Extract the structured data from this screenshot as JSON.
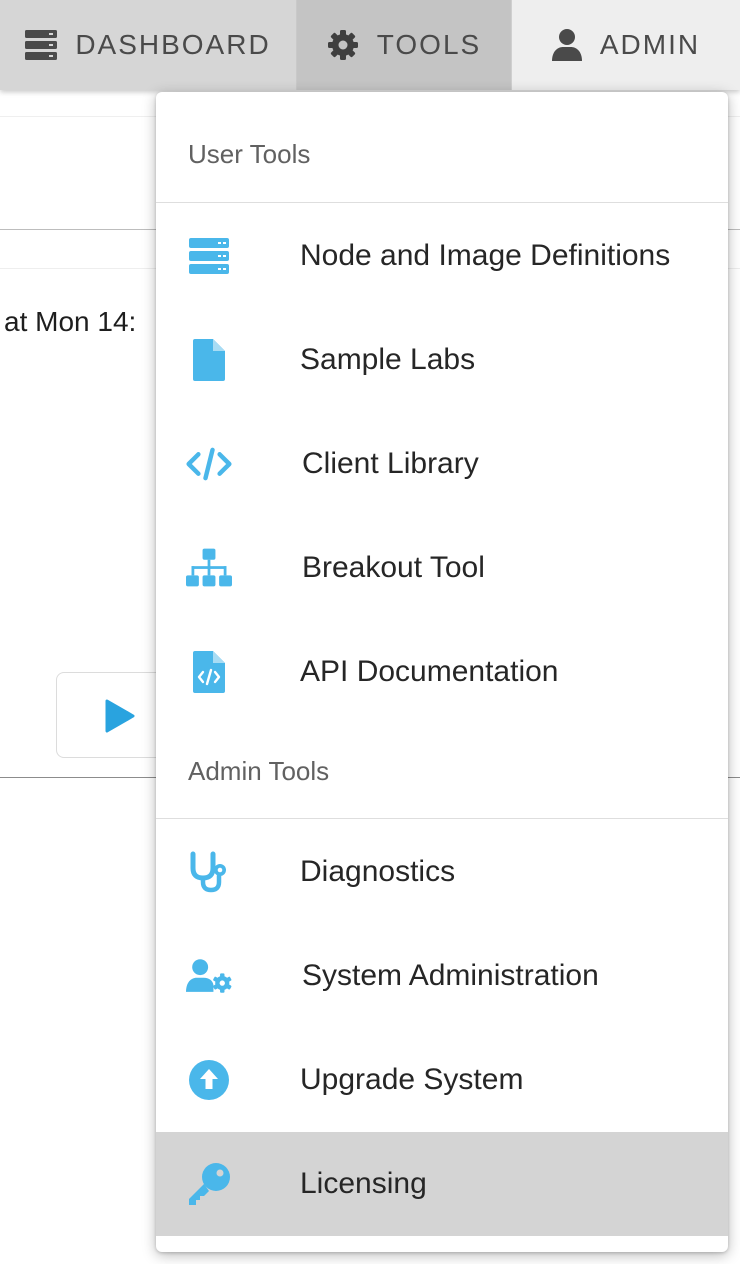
{
  "navbar": {
    "items": [
      {
        "label": "DASHBOARD",
        "icon": "server-stack-icon"
      },
      {
        "label": "TOOLS",
        "icon": "gear-icon"
      },
      {
        "label": "ADMIN",
        "icon": "user-icon"
      }
    ]
  },
  "background": {
    "card_text": "at Mon 14:"
  },
  "menu": {
    "user_tools_header": "User Tools",
    "admin_tools_header": "Admin Tools",
    "user_items": [
      {
        "label": "Node and Image Definitions",
        "icon": "server-icon"
      },
      {
        "label": "Sample Labs",
        "icon": "file-icon"
      },
      {
        "label": "Client Library",
        "icon": "code-icon"
      },
      {
        "label": "Breakout Tool",
        "icon": "sitemap-icon"
      },
      {
        "label": "API Documentation",
        "icon": "file-code-icon"
      }
    ],
    "admin_items": [
      {
        "label": "Diagnostics",
        "icon": "stethoscope-icon"
      },
      {
        "label": "System Administration",
        "icon": "user-gear-icon"
      },
      {
        "label": "Upgrade System",
        "icon": "circle-arrow-up-icon"
      },
      {
        "label": "Licensing",
        "icon": "key-icon"
      }
    ]
  },
  "colors": {
    "icon_blue": "#4ab7ea",
    "active_item_bg": "#d4d4d4",
    "navbar_bg": "#d9d9d9"
  }
}
